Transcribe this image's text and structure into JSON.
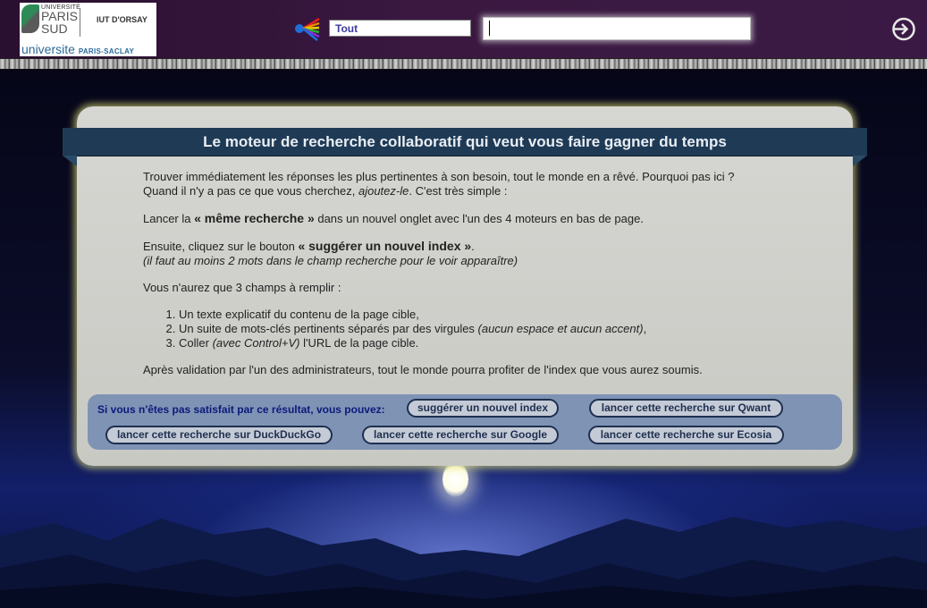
{
  "header": {
    "logo": {
      "univ": "UNIVERSITÉ",
      "paris": "PARIS",
      "sud": "SUD",
      "iut": "IUT D'ORSAY",
      "saclay_main": "universite",
      "saclay_small": "PARIS-SACLAY"
    },
    "engine_icon": "multicolor-engines-icon",
    "select_value": "Tout",
    "search_value": "",
    "login_icon": "login-icon"
  },
  "main": {
    "title": "Le moteur de recherche collaboratif qui veut vous faire gagner du temps",
    "p1_line1": "Trouver immédiatement les réponses les plus pertinentes à son besoin, tout le monde en a rêvé. Pourquoi pas ici ?",
    "p1_line2_a": "Quand il n'y a pas ce que vous cherchez, ",
    "p1_line2_em": "ajoutez-le",
    "p1_line2_b": ". C'est très simple :",
    "p2_a": "Lancer la ",
    "p2_b": "« même recherche »",
    "p2_c": " dans un nouvel onglet avec l'un des 4 moteurs en bas de page.",
    "p3_a": "Ensuite, cliquez sur le bouton ",
    "p3_b": "« suggérer un nouvel index »",
    "p3_c": ".",
    "p3_note": "(il faut au moins 2 mots dans le champ recherche pour le voir apparaître)",
    "p4": "Vous n'aurez que 3 champs à remplir :",
    "li1": "Un texte explicatif du contenu de la page cible,",
    "li2_a": "Un suite de mots-clés pertinents séparés par des virgules ",
    "li2_em": "(aucun espace et aucun accent)",
    "li2_b": ",",
    "li3_a": "Coller ",
    "li3_em": "(avec Control+V)",
    "li3_b": " l'URL de la page cible.",
    "p5": "Après validation par l'un des administrateurs, tout le monde pourra profiter de l'index que vous aurez soumis."
  },
  "suggest": {
    "label": "Si vous n'êtes pas satisfait par ce résultat, vous pouvez:",
    "btn_suggest": "suggérer un nouvel index",
    "btn_qwant": "lancer cette recherche sur Qwant",
    "btn_ddg": "lancer cette recherche sur DuckDuckGo",
    "btn_google": "lancer cette recherche sur Google",
    "btn_ecosia": "lancer cette recherche sur Ecosia"
  }
}
